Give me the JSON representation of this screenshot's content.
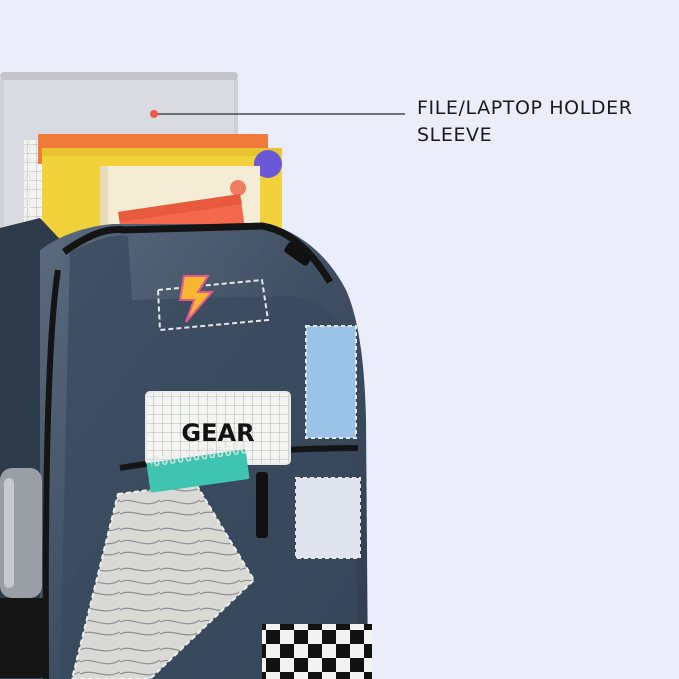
{
  "callout": {
    "label": "FILE/LAPTOP HOLDER\nSLEEVE"
  },
  "patch": {
    "text": "GEAR"
  },
  "colors": {
    "background": "#ebedfb",
    "callout_dot": "#ea5a4f",
    "denim": "#3d4c5e",
    "laptop": "#cfd1d6",
    "pouch": "#f4694b"
  }
}
